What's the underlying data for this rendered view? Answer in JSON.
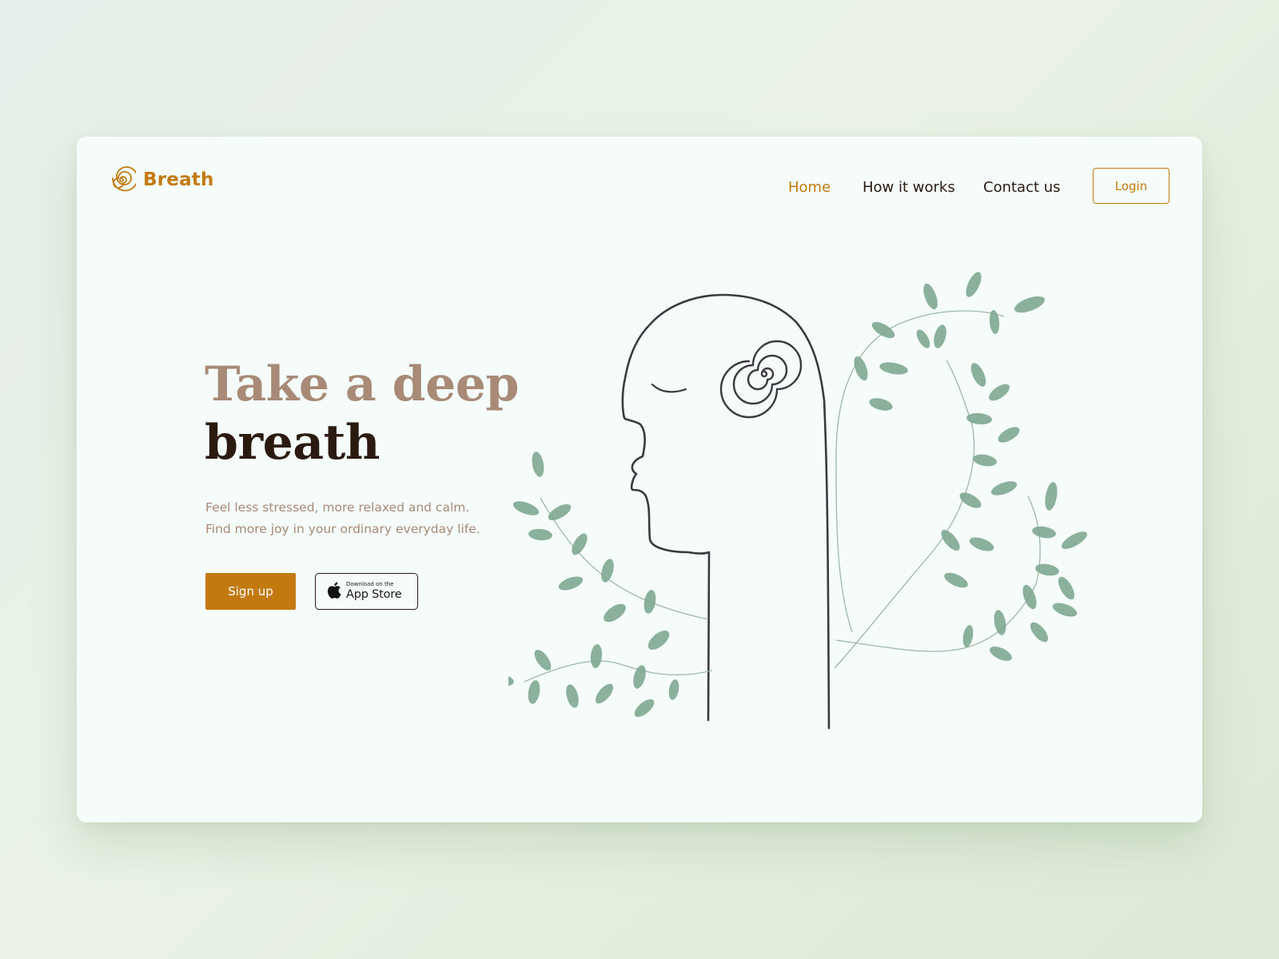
{
  "brand": {
    "name": "Breath",
    "logo_icon": "spiral-icon",
    "accent_color": "#c27a10"
  },
  "nav": {
    "items": [
      {
        "label": "Home",
        "active": true
      },
      {
        "label": "How it works",
        "active": false
      },
      {
        "label": "Contact us",
        "active": false
      }
    ],
    "login_label": "Login"
  },
  "hero": {
    "title_line1": "Take a deep",
    "title_line2": "breath",
    "subtitle_line1": "Feel less stressed, more relaxed and calm.",
    "subtitle_line2": "Find more joy in your ordinary everyday life.",
    "signup_label": "Sign up",
    "appstore": {
      "small_text": "Download on the",
      "big_text": "App Store",
      "icon": "apple-icon"
    }
  },
  "illustration": {
    "subject": "face-profile-with-spiral-and-leaves",
    "leaf_color": "#7fa891",
    "line_color": "#3a3a40"
  },
  "colors": {
    "background": "#e6efe9",
    "card": "#f5fcfa",
    "title_light": "#a88a77",
    "title_dark": "#2a1a10",
    "text_dark": "#2a1a12"
  }
}
